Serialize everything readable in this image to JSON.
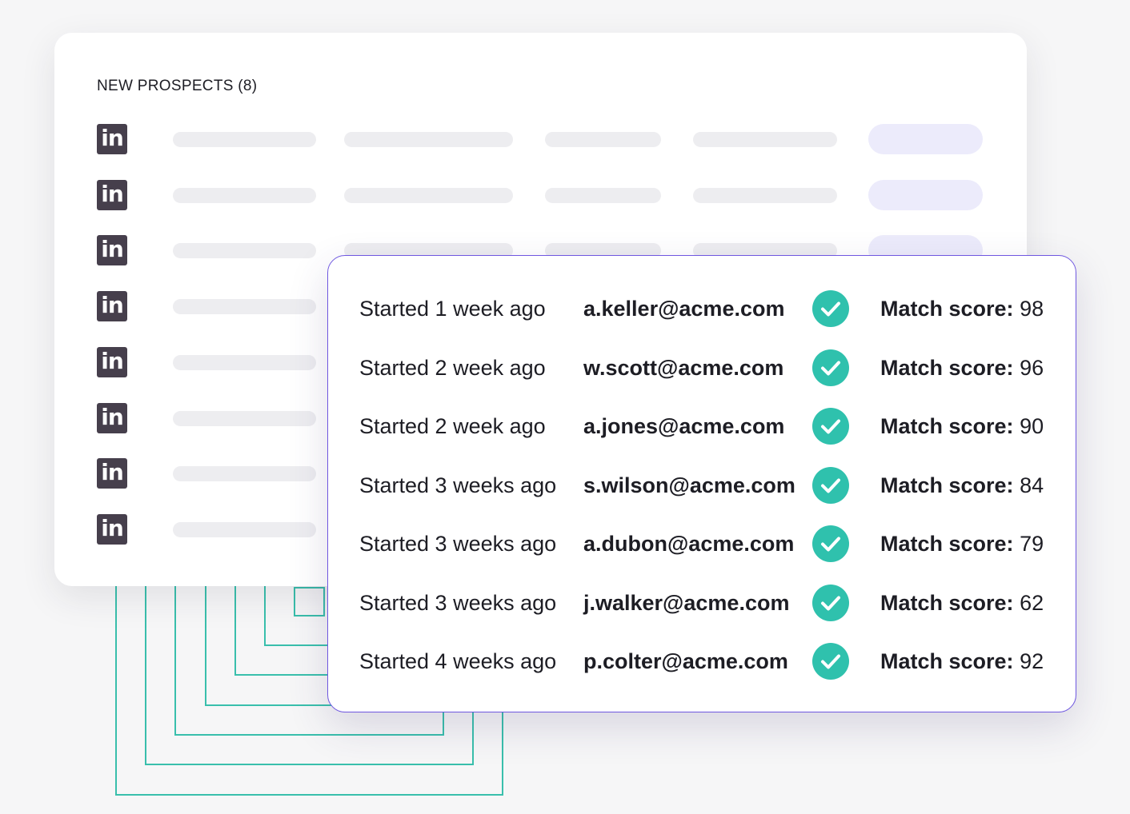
{
  "prospects_panel": {
    "title": "NEW PROSPECTS (8)",
    "row_icon": "linkedin-icon",
    "linkedin_glyph": "in",
    "row_count": 8
  },
  "contacts_panel": {
    "check_icon": "check-circle-icon",
    "score_label": "Match score:",
    "rows": [
      {
        "started": "Started 1 week ago",
        "email": "a.keller@acme.com",
        "score": "98"
      },
      {
        "started": "Started 2 week ago",
        "email": "w.scott@acme.com",
        "score": "96"
      },
      {
        "started": "Started 2 week ago",
        "email": "a.jones@acme.com",
        "score": "90"
      },
      {
        "started": "Started 3 weeks ago",
        "email": "s.wilson@acme.com",
        "score": "84"
      },
      {
        "started": "Started 3 weeks ago",
        "email": "a.dubon@acme.com",
        "score": "79"
      },
      {
        "started": "Started 3 weeks ago",
        "email": "j.walker@acme.com",
        "score": "62"
      },
      {
        "started": "Started 4 weeks ago",
        "email": "p.colter@acme.com",
        "score": "92"
      }
    ]
  },
  "colors": {
    "accent_border": "#6f57e0",
    "check_green": "#2fc1ad",
    "linkedin_icon": "#463f4c",
    "decor_lines": "#39bfac",
    "placeholder_bar": "#ededf0",
    "placeholder_pill": "#ecebfb"
  }
}
